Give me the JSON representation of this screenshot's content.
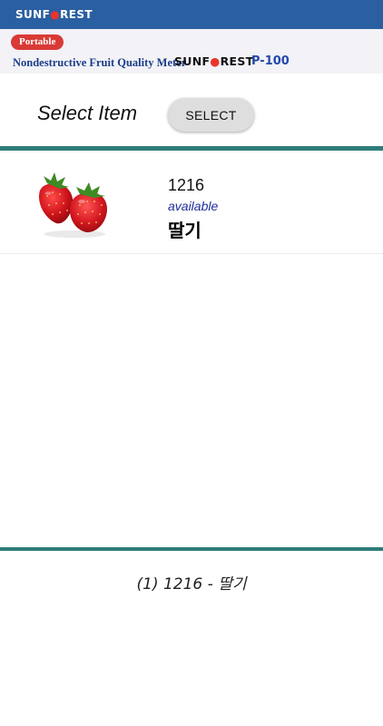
{
  "appbar": {
    "logo_pre": "SUNF",
    "logo_flame": "●",
    "logo_post": "REST"
  },
  "banner": {
    "badge": "Portable",
    "subtitle": "Nondestructive Fruit Quality Meter",
    "brand_pre": "SUNF",
    "brand_flame": "●",
    "brand_post": "REST",
    "model": "P-100"
  },
  "selector": {
    "label": "Select Item",
    "button_label": "SELECT"
  },
  "items": [
    {
      "code": "1216",
      "status": "available",
      "name": "딸기",
      "image_icon": "strawberry-image"
    }
  ],
  "footer": {
    "selected_text": "(1) 1216 - 딸기"
  },
  "colors": {
    "appbar": "#2a5fa2",
    "banner_bg": "#f2f2f7",
    "badge": "#d93a36",
    "divider": "#2e7d78",
    "status_text": "#1d2e9a"
  }
}
